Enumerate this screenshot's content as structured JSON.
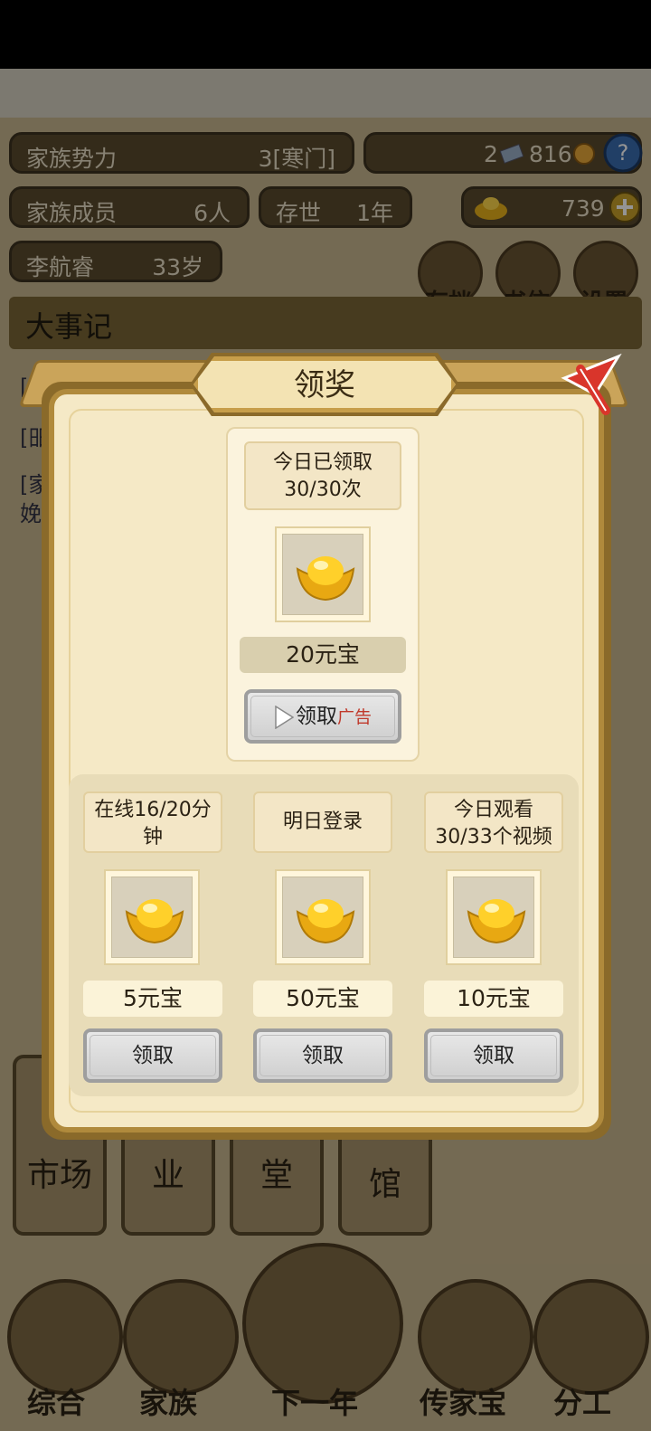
{
  "header": {
    "family_power_label": "家族势力",
    "family_power_value": "3[寒门]",
    "currency_1_value_a": "2",
    "currency_1_value_b": "816",
    "members_label": "家族成员",
    "members_value": "6人",
    "existed_label": "存世",
    "existed_value": "1年",
    "ingot_value": "739",
    "character_name": "李航睿",
    "character_age": "33岁",
    "buttons": {
      "save": "存档",
      "letters": "书信",
      "settings": "设置"
    }
  },
  "events": {
    "title": "大事记",
    "log_line_1": "[",
    "log_line_2": "[昍",
    "log_line_3": "[家",
    "log_line_4": "娩"
  },
  "background_cards": [
    "市场",
    "业",
    "堂",
    "馆"
  ],
  "bottom_nav": {
    "items": [
      "综合",
      "家族",
      "下一年",
      "传家宝",
      "分工"
    ]
  },
  "modal": {
    "title": "领奖",
    "main_reward": {
      "status": "今日已领取",
      "count": "30/30次",
      "amount": "20元宝",
      "button_label": "领取",
      "button_ad_label": "广告"
    },
    "rewards": [
      {
        "condition": "在线16/20分钟",
        "amount": "5元宝",
        "button_label": "领取"
      },
      {
        "condition": "明日登录",
        "amount": "50元宝",
        "button_label": "领取"
      },
      {
        "condition": "今日观看30/33个视频",
        "amount": "10元宝",
        "button_label": "领取"
      }
    ]
  },
  "colors": {
    "accent": "#c79e4a",
    "ad_text": "#c0392b",
    "ingot": "#f2c21a"
  },
  "icons": [
    "play-icon",
    "gold-ingot-icon",
    "close-icon",
    "help-icon",
    "plus-icon",
    "coin-icon"
  ]
}
